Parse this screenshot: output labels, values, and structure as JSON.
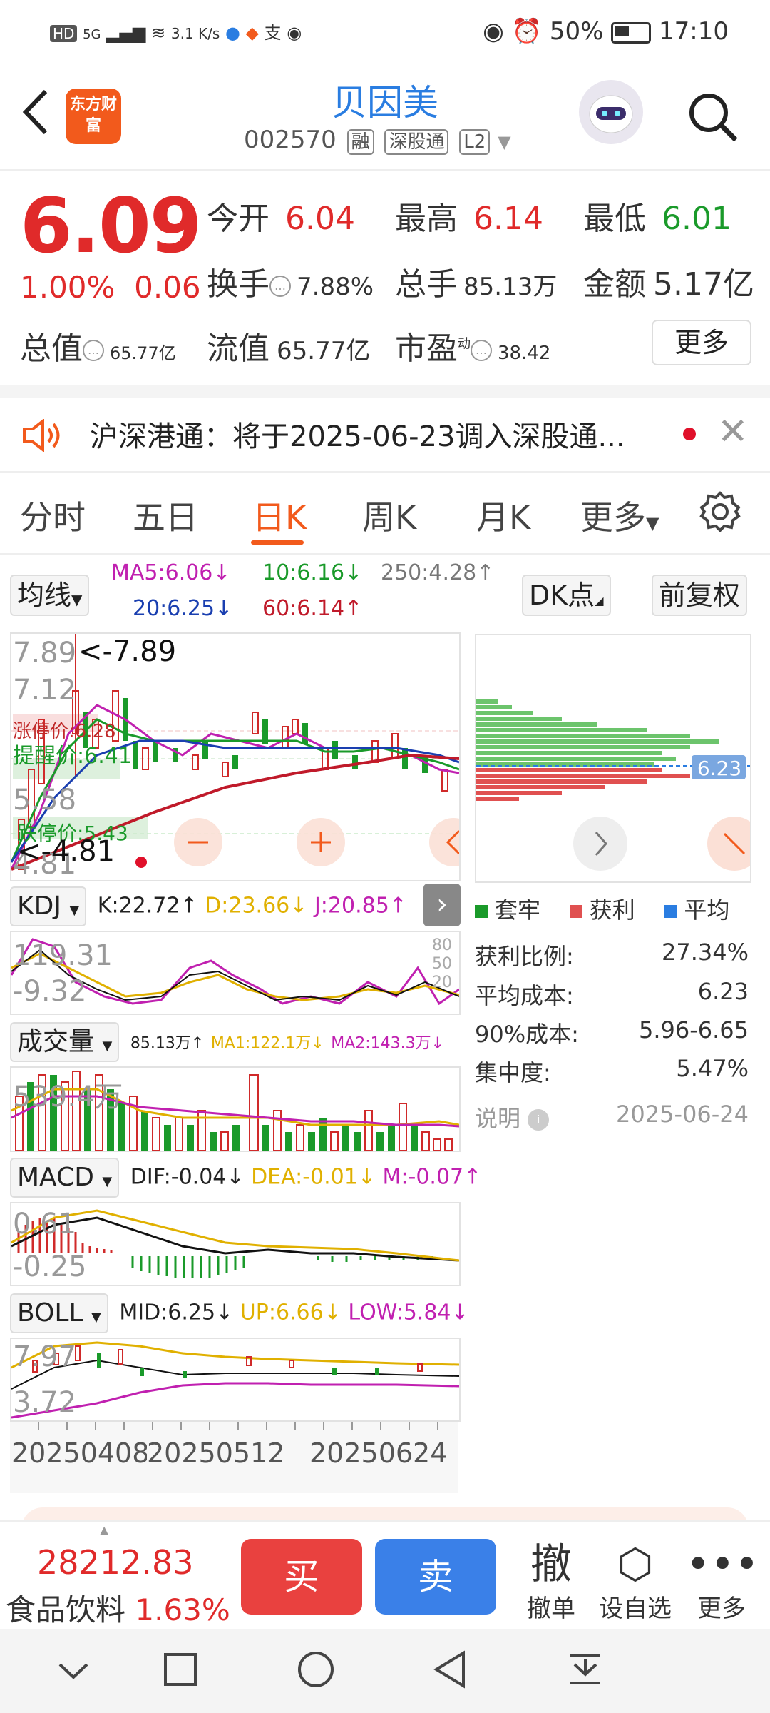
{
  "status": {
    "left_icons": "HD 5G ▂▄▆ 📶",
    "speed": "3.1\nK/s",
    "battery": "50%",
    "time": "17:10"
  },
  "header": {
    "logo_text": "东方财富",
    "stock_name": "贝因美",
    "code": "002570",
    "tags": [
      "融",
      "深股通",
      "L2"
    ]
  },
  "quote": {
    "price": "6.09",
    "change_pct": "1.00%",
    "change_amt": "0.06",
    "open_label": "今开",
    "open": "6.04",
    "high_label": "最高",
    "high": "6.14",
    "low_label": "最低",
    "low": "6.01",
    "turnover_label": "换手",
    "turnover": "7.88%",
    "volume_label": "总手",
    "volume": "85.13万",
    "amount_label": "金额",
    "amount": "5.17亿",
    "mktcap_label": "总值",
    "mktcap": "65.77亿",
    "float_label": "流值",
    "float": "65.77亿",
    "pe_label": "市盈",
    "pe_sup": "动",
    "pe": "38.42",
    "more": "更多"
  },
  "notice": {
    "text": "沪深港通：将于2025-06-23调入深股通..."
  },
  "tabs": [
    "分时",
    "五日",
    "日K",
    "周K",
    "月K",
    "更多"
  ],
  "ma": {
    "selector": "均线",
    "ma5": "MA5:6.06↓",
    "ma10": "10:6.16↓",
    "ma250": "250:4.28↑",
    "ma20": "20:6.25↓",
    "ma60": "60:6.14↑",
    "dk": "DK点",
    "adjust": "前复权"
  },
  "kline": {
    "high_label": "7.89",
    "high_mark": "<-7.89",
    "y2": "7.12",
    "y3": "6.3",
    "y4": "5.58",
    "low_label": "4.81",
    "low_mark": "<-4.81",
    "warn": "提醒价:6.41",
    "warn2": "涨停价:6.28",
    "drop": "跌停价:5.43"
  },
  "kdj": {
    "selector": "KDJ",
    "k": "K:22.72↑",
    "d": "D:23.66↓",
    "j": "J:20.85↑",
    "top": "119.31",
    "bottom": "-9.32",
    "lvl80": "80",
    "lvl50": "50",
    "lvl20": "20"
  },
  "volume": {
    "selector": "成交量",
    "v": "85.13万↑",
    "ma1": "MA1:122.1万↓",
    "ma2": "MA2:143.3万↓",
    "top": "539.4万"
  },
  "macd": {
    "selector": "MACD",
    "dif": "DIF:-0.04↓",
    "dea": "DEA:-0.01↓",
    "m": "M:-0.07↑",
    "top": "0.61",
    "bottom": "-0.25"
  },
  "boll": {
    "selector": "BOLL",
    "mid": "MID:6.25↓",
    "up": "UP:6.66↓",
    "low": "LOW:5.84↓",
    "top": "7.97",
    "bottom": "3.72"
  },
  "dates": [
    "20250408",
    "20250512",
    "20250624"
  ],
  "chip": {
    "avg_price": "6.23",
    "legend": [
      "套牢",
      "获利",
      "平均"
    ],
    "profit_label": "获利比例:",
    "profit": "27.34%",
    "avgcost_label": "平均成本:",
    "avgcost": "6.23",
    "cost90_label": "90%成本:",
    "cost90": "5.96-6.65",
    "concentration_label": "集中度:",
    "concentration": "5.47%",
    "note_label": "说明",
    "date": "2025-06-24"
  },
  "trade": {
    "index_value": "28212.83",
    "index_name": "食品饮料",
    "index_pct": "1.63%",
    "buy": "买",
    "sell": "卖",
    "cancel": "撤单",
    "fav": "设自选",
    "more": "更多"
  },
  "colors": {
    "red": "#e02a2a",
    "green": "#1a9a2a",
    "blue": "#2a7de1",
    "orange": "#f25a1c"
  }
}
